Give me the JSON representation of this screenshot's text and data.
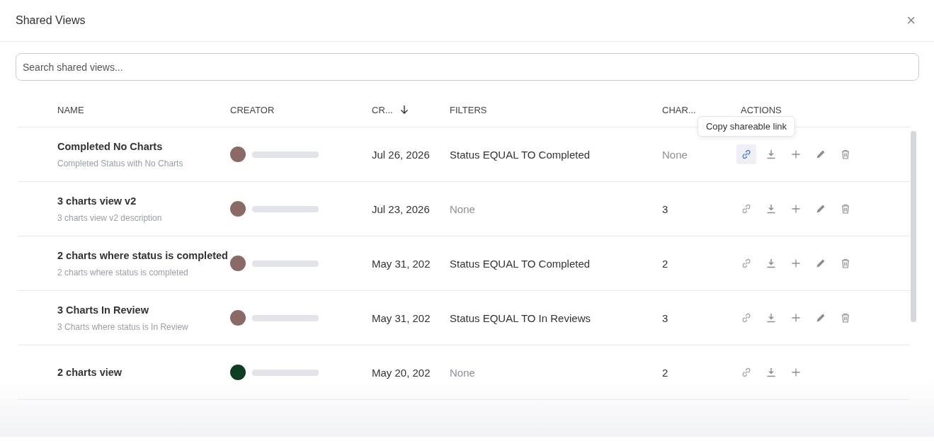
{
  "dialog": {
    "title": "Shared Views",
    "close": "×"
  },
  "search": {
    "placeholder": "Search shared views..."
  },
  "table": {
    "columns": [
      {
        "label": "NAME",
        "sorted": false
      },
      {
        "label": "CREATOR",
        "sorted": false
      },
      {
        "label": "CR...",
        "sorted": true
      },
      {
        "label": "FILTERS",
        "sorted": false
      },
      {
        "label": "CHAR...",
        "sorted": false
      },
      {
        "label": "ACTIONS",
        "sorted": false
      }
    ],
    "rows": [
      {
        "name": "Completed No Charts",
        "description": "Completed Status with No Charts",
        "avatar": {
          "color": "#8a6a66"
        },
        "date": "Jul 26, 2026",
        "filters": "Status EQUAL TO Completed",
        "filters_empty": false,
        "charts": "None",
        "charts_empty": true,
        "link_hovered": true,
        "editable": true
      },
      {
        "name": "3 charts view v2",
        "description": "3 charts view v2 description",
        "avatar": {
          "color": "#8a6a66"
        },
        "date": "Jul 23, 2026",
        "filters": "None",
        "filters_empty": true,
        "charts": "3",
        "charts_empty": false,
        "link_hovered": false,
        "editable": true
      },
      {
        "name": "2 charts where status is completed",
        "description": "2 charts where status is completed",
        "avatar": {
          "color": "#8a6a66"
        },
        "date": "May 31, 202",
        "filters": "Status EQUAL TO Completed",
        "filters_empty": false,
        "charts": "2",
        "charts_empty": false,
        "link_hovered": false,
        "editable": true
      },
      {
        "name": "3 Charts In Review",
        "description": "3 Charts where status is In Review",
        "avatar": {
          "color": "#8a6a66"
        },
        "date": "May 31, 202",
        "filters": "Status EQUAL TO In Reviews",
        "filters_empty": false,
        "charts": "3",
        "charts_empty": false,
        "link_hovered": false,
        "editable": true
      },
      {
        "name": "2 charts view",
        "avatar": {
          "color": "#0f3d22"
        },
        "date": "May 20, 202",
        "filters": "None",
        "filters_empty": true,
        "charts": "2",
        "charts_empty": false,
        "link_hovered": false,
        "editable": false
      }
    ]
  },
  "tooltip": {
    "text": "Copy shareable link"
  }
}
